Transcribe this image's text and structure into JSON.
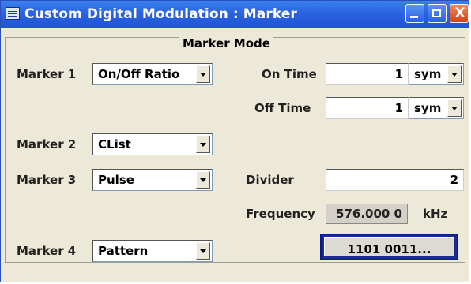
{
  "window": {
    "title": "Custom Digital Modulation : Marker",
    "close_glyph": "X"
  },
  "group": {
    "title": "Marker Mode"
  },
  "marker1": {
    "label": "Marker 1",
    "mode": "On/Off Ratio"
  },
  "on_time": {
    "label": "On Time",
    "value": "1",
    "unit": "sym"
  },
  "off_time": {
    "label": "Off Time",
    "value": "1",
    "unit": "sym"
  },
  "marker2": {
    "label": "Marker 2",
    "mode": "CList"
  },
  "marker3": {
    "label": "Marker 3",
    "mode": "Pulse"
  },
  "divider": {
    "label": "Divider",
    "value": "2"
  },
  "frequency": {
    "label": "Frequency",
    "value": "576.000 0",
    "unit": "kHz"
  },
  "marker4": {
    "label": "Marker 4",
    "mode": "Pattern",
    "pattern": "1101 0011..."
  },
  "icons": [
    "window-app-icon",
    "minimize-icon",
    "maximize-icon",
    "close-icon",
    "chevron-down-icon"
  ],
  "colors": {
    "titlebar": "#2b63e0",
    "panel": "#ece9d8",
    "focus_border": "#1c2b93"
  }
}
